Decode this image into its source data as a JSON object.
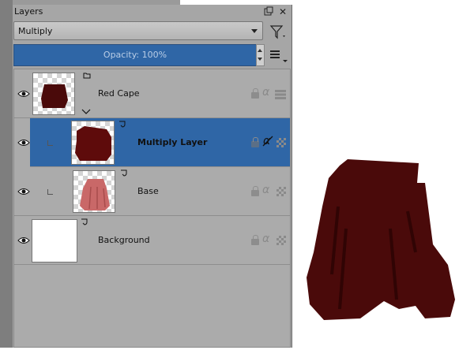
{
  "panel": {
    "title": "Layers",
    "blending_mode": "Multiply",
    "opacity_label": "Opacity:",
    "opacity_value": "100%"
  },
  "layers": [
    {
      "name": "Red Cape",
      "thumbnail": "dark-red-cape",
      "type": "group",
      "selected": false,
      "indent": 0
    },
    {
      "name": "Multiply Layer",
      "thumbnail": "dark-red-blob",
      "type": "paint",
      "selected": true,
      "indent": 1
    },
    {
      "name": "Base",
      "thumbnail": "pink-cape",
      "type": "paint",
      "selected": false,
      "indent": 1
    },
    {
      "name": "Background",
      "thumbnail": "white",
      "type": "paint",
      "selected": false,
      "indent": 0
    }
  ],
  "colors": {
    "selection": "#2f66a6",
    "cape_dark": "#4a0a0a",
    "cape_pink": "#c96868"
  },
  "icons": [
    "eye-icon",
    "lock-icon",
    "alpha-icon",
    "inherit-alpha-icon",
    "filter-icon",
    "hamburger-menu-icon",
    "float-icon",
    "close-icon"
  ]
}
